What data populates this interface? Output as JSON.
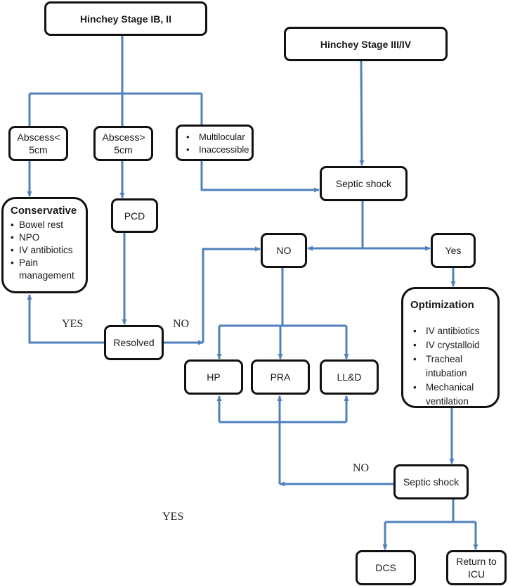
{
  "diagram": {
    "line_color": "#4f81bd",
    "border_color": "#111111",
    "nodes": {
      "hinchey_1b_2": "Hinchey Stage IB, II",
      "hinchey_3_4": "Hinchey Stage III/IV",
      "abscess_lt_5": "Abscess< 5cm",
      "abscess_gt_5": "Abscess> 5cm",
      "multilocular": {
        "items": [
          "Multilocular",
          "Inaccessible"
        ]
      },
      "septic_shock_1": "Septic shock",
      "conservative": {
        "title": "Conservative",
        "items": [
          "Bowel rest",
          "NPO",
          "IV antibiotics",
          "Pain management"
        ]
      },
      "pcd": "PCD",
      "no_node": "NO",
      "yes_node": "Yes",
      "optimization": {
        "title": "Optimization",
        "items": [
          "IV antibiotics",
          "IV crystalloid",
          "Tracheal intubation",
          "Mechanical ventilation"
        ]
      },
      "resolved": "Resolved",
      "hp": "HP",
      "pra": "PRA",
      "lld": "LL&D",
      "septic_shock_2": "Septic shock",
      "dcs": "DCS",
      "return_icu": "Return to ICU"
    },
    "labels": {
      "yes_resolved": "YES",
      "no_resolved": "NO",
      "no_septic2": "NO",
      "yes_septic2": "YES"
    }
  }
}
